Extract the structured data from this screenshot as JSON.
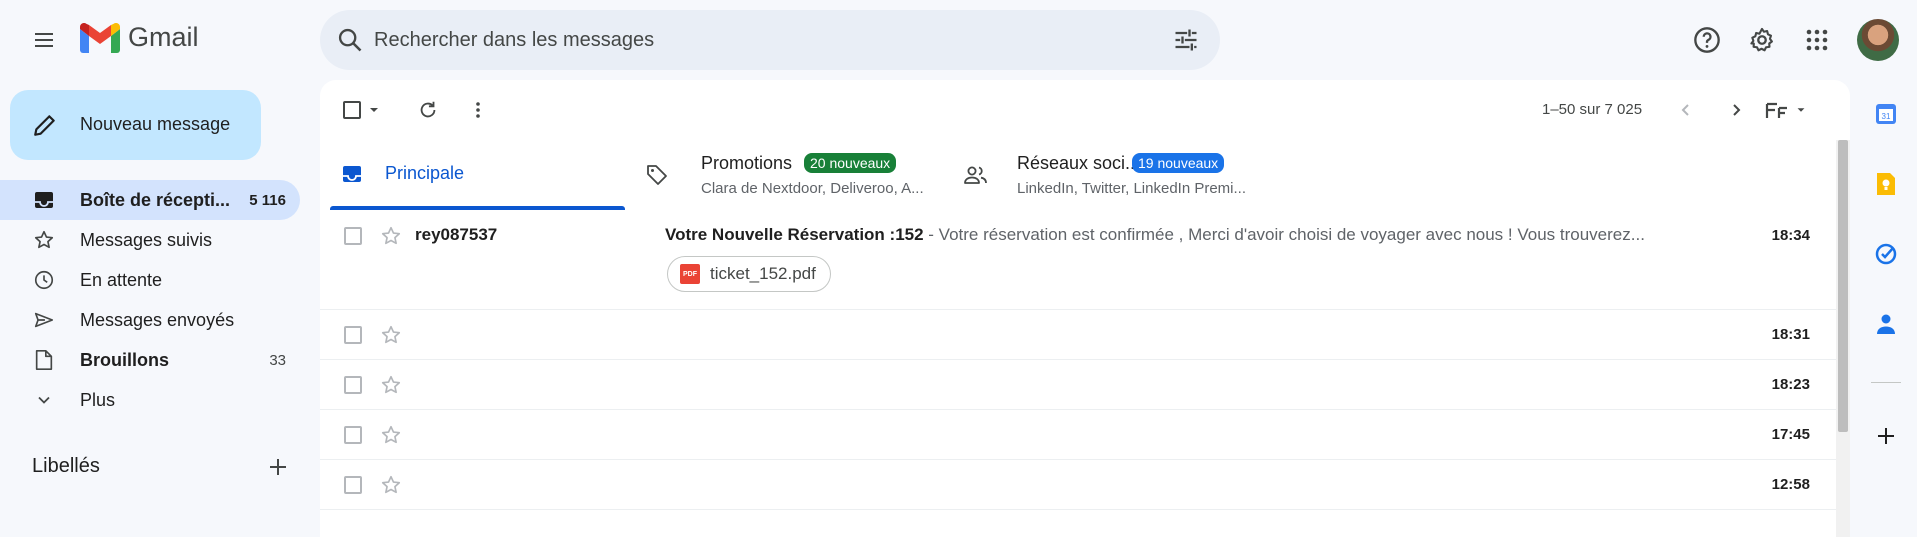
{
  "app": {
    "name": "Gmail",
    "search_placeholder": "Rechercher dans les messages"
  },
  "sidebar": {
    "compose_label": "Nouveau message",
    "items": [
      {
        "label": "Boîte de récepti...",
        "count": "5 116",
        "icon": "inbox-icon"
      },
      {
        "label": "Messages suivis",
        "count": "",
        "icon": "star-icon"
      },
      {
        "label": "En attente",
        "count": "",
        "icon": "clock-icon"
      },
      {
        "label": "Messages envoyés",
        "count": "",
        "icon": "send-icon"
      },
      {
        "label": "Brouillons",
        "count": "33",
        "icon": "draft-icon"
      },
      {
        "label": "Plus",
        "count": "",
        "icon": "chevron-down-icon"
      }
    ],
    "labels_title": "Libellés"
  },
  "toolbar": {
    "pagination": "1–50 sur 7 025"
  },
  "tabs": [
    {
      "title": "Principale",
      "subtitle": "",
      "badge": "",
      "icon": "inbox-icon"
    },
    {
      "title": "Promotions",
      "subtitle": "Clara de Nextdoor, Deliveroo, A...",
      "badge": "20 nouveaux",
      "badge_color": "#188038",
      "icon": "tag-icon"
    },
    {
      "title": "Réseaux soci...",
      "subtitle": "LinkedIn, Twitter, LinkedIn Premi...",
      "badge": "19 nouveaux",
      "badge_color": "#1a73e8",
      "icon": "people-icon"
    }
  ],
  "emails": [
    {
      "sender": "rey087537",
      "subject": "Votre Nouvelle Réservation :152",
      "snippet": " - Votre réservation est confirmée , Merci d'avoir choisi de voyager avec nous ! Vous trouverez...",
      "time": "18:34",
      "attachment": "ticket_152.pdf"
    },
    {
      "sender": "",
      "subject": "",
      "snippet": "",
      "time": "18:31"
    },
    {
      "sender": "",
      "subject": "",
      "snippet": "",
      "time": "18:23"
    },
    {
      "sender": "",
      "subject": "",
      "snippet": "",
      "time": "17:45"
    },
    {
      "sender": "",
      "subject": "",
      "snippet": "",
      "time": "12:58"
    }
  ],
  "colors": {
    "accent": "#0b57d0",
    "compose_bg": "#c2e7ff",
    "active_nav_bg": "#d3e3fd",
    "page_bg": "#f6f8fc"
  }
}
